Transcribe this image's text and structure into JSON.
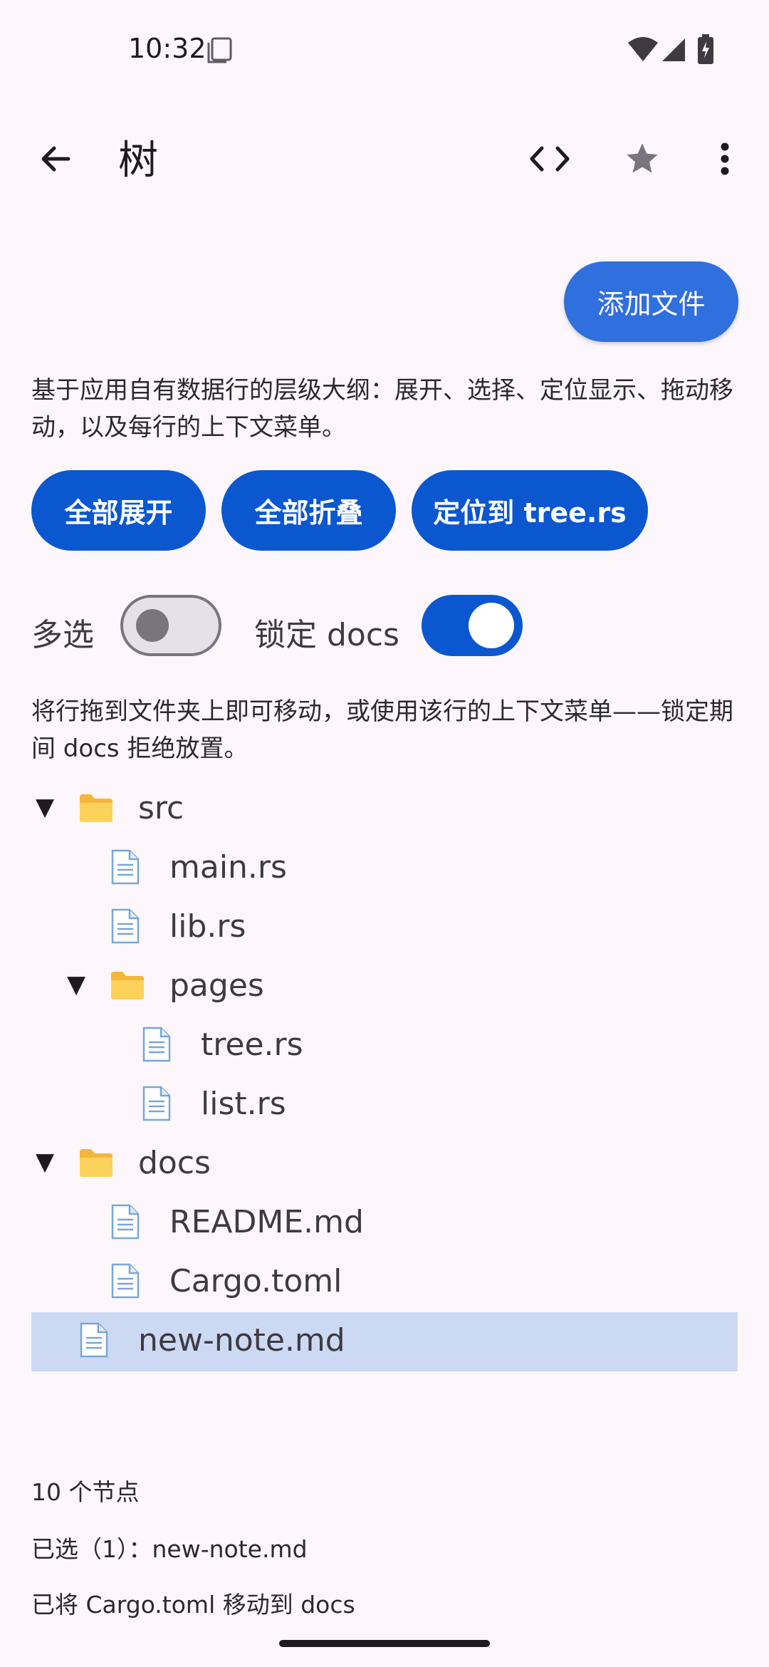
{
  "status_bar": {
    "time": "10:32",
    "icons": [
      "screenshot-icon",
      "wifi-icon",
      "signal-icon",
      "battery-charging-icon"
    ]
  },
  "app_bar": {
    "title": "树",
    "icons": [
      "back-arrow-icon",
      "code-icon",
      "star-icon",
      "more-vert-icon"
    ]
  },
  "add_file_label": "添加文件",
  "description": "基于应用自有数据行的层级大纲：展开、选择、定位显示、拖动移动，以及每行的上下文菜单。",
  "actions": {
    "expand_all": "全部展开",
    "collapse_all": "全部折叠",
    "reveal": "定位到 tree.rs"
  },
  "toggles": {
    "multiselect_label": "多选",
    "multiselect_on": false,
    "lock_label": "锁定 docs",
    "lock_on": true
  },
  "hint": "将行拖到文件夹上即可移动，或使用该行的上下文菜单——锁定期间 docs 拒绝放置。",
  "tree": [
    {
      "name": "src",
      "type": "folder",
      "depth": 0,
      "expanded": true,
      "arrow": "▼",
      "icon": "folder-icon"
    },
    {
      "name": "main.rs",
      "type": "file",
      "depth": 1,
      "icon": "file-icon"
    },
    {
      "name": "lib.rs",
      "type": "file",
      "depth": 1,
      "icon": "file-icon"
    },
    {
      "name": "pages",
      "type": "folder",
      "depth": 1,
      "expanded": true,
      "arrow": "▼",
      "icon": "folder-icon"
    },
    {
      "name": "tree.rs",
      "type": "file",
      "depth": 2,
      "icon": "file-icon"
    },
    {
      "name": "list.rs",
      "type": "file",
      "depth": 2,
      "icon": "file-icon"
    },
    {
      "name": "docs",
      "type": "folder",
      "depth": 0,
      "expanded": true,
      "arrow": "▼",
      "icon": "folder-icon"
    },
    {
      "name": "README.md",
      "type": "file",
      "depth": 1,
      "icon": "file-icon"
    },
    {
      "name": "Cargo.toml",
      "type": "file",
      "depth": 1,
      "icon": "file-icon"
    },
    {
      "name": "new-note.md",
      "type": "file",
      "depth": 0,
      "icon": "file-icon",
      "selected": true
    }
  ],
  "footer": {
    "node_count": "10 个节点",
    "selected": "已选（1）：new-note.md",
    "last_action": "已将 Cargo.toml 移动到 docs"
  },
  "colors": {
    "accent": "#0b57d0",
    "fab": "#2f6fde",
    "selected_row": "#ccd9f3",
    "background": "#fdf7fc"
  }
}
